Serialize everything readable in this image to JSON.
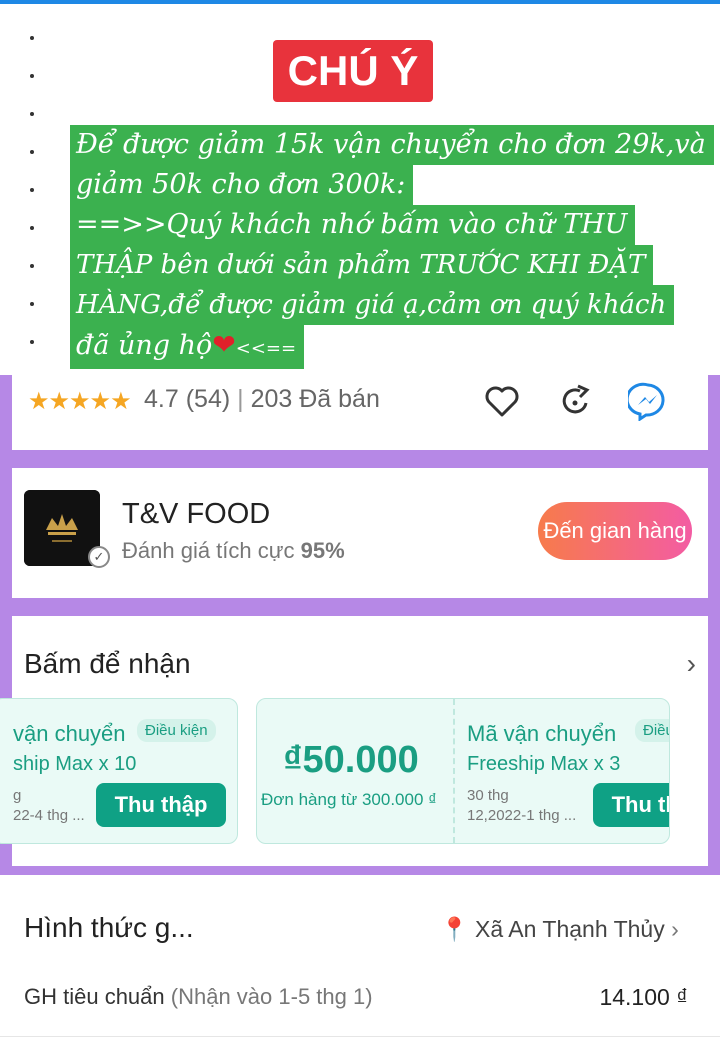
{
  "notice": {
    "title": "CHÚ Ý",
    "lines": [
      "Để được giảm 15k vận chuyển cho đơn 29k,và",
      "giảm 50k cho đơn 300k:",
      "==>>Quý khách nhớ bấm vào chữ THU",
      "THẬP bên dưới sản phẩm TRƯỚC KHI ĐẶT",
      "HÀNG,để được giảm giá ạ,cảm ơn quý khách",
      "đã ủng hộ"
    ],
    "tail": "<<=="
  },
  "rating": {
    "score": "4.7",
    "count": "(54)",
    "divider": "|",
    "sold": "203 Đã bán",
    "stars": 4.7
  },
  "shop": {
    "name": "T&V FOOD",
    "rating_label": "Đánh giá tích cực",
    "rating_value": "95%",
    "button": "Đến gian hàng"
  },
  "vouchers": {
    "title": "Bấm để nhận",
    "items": [
      {
        "title": "vận chuyển",
        "tag": "Điều kiện",
        "sub": "ship Max x 10",
        "date1": "g",
        "date2": "22-4 thg ...",
        "button": "Thu thập"
      },
      {
        "amount": "₫50.000",
        "sub": "Đơn hàng từ 300.000 ₫"
      },
      {
        "title": "Mã vận chuyển",
        "tag": "Điều kiệ",
        "sub": "Freeship Max x 3",
        "date1": "30 thg",
        "date2": "12,2022-1 thg ...",
        "button": "Thu thập"
      }
    ]
  },
  "shipping": {
    "title": "Hình thức g...",
    "location": "Xã An Thạnh Thủy",
    "standard": "GH tiêu chuẩn",
    "eta": "(Nhận vào 1-5 thg 1)",
    "price": "14.100 ₫"
  },
  "colors": {
    "notice_bg": "#3bb14f",
    "chuy_bg": "#e8333c",
    "frame": "#b688e6",
    "voucher_green": "#0fa185",
    "star": "#f5a623"
  }
}
